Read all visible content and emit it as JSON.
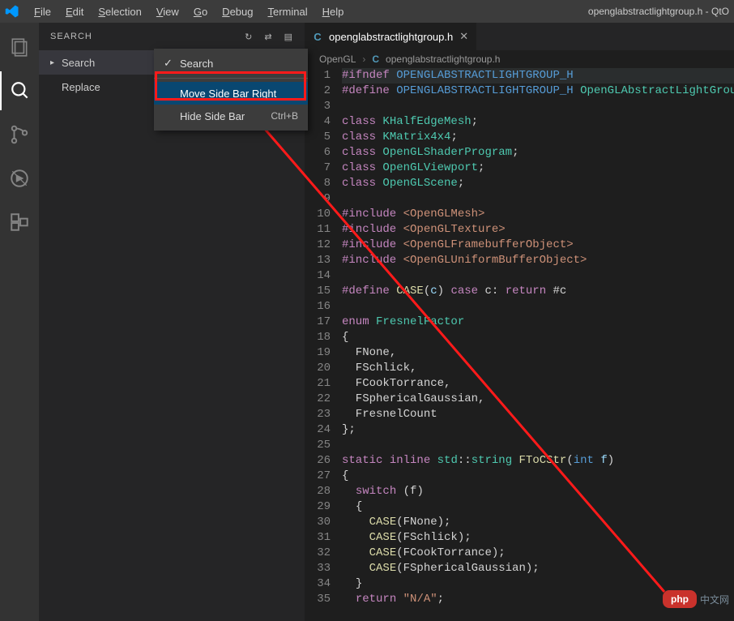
{
  "title_right": "openglabstractlightgroup.h - QtO",
  "menubar": [
    "File",
    "Edit",
    "Selection",
    "View",
    "Go",
    "Debug",
    "Terminal",
    "Help"
  ],
  "sidebar": {
    "title": "SEARCH",
    "rows": [
      {
        "label": "Search",
        "selected": true
      },
      {
        "label": "Replace",
        "selected": false
      }
    ]
  },
  "ctx": {
    "items": [
      {
        "label": "Search",
        "check": true
      },
      {
        "label": "Move Side Bar Right",
        "hl": true
      },
      {
        "label": "Hide Side Bar",
        "kb": "Ctrl+B"
      }
    ]
  },
  "tab": {
    "name": "openglabstractlightgroup.h"
  },
  "breadcrumb": {
    "folder": "OpenGL",
    "file": "openglabstractlightgroup.h"
  },
  "code": [
    {
      "n": 1,
      "html": "<span class='kw'>#ifndef</span> <span class='mac'>OPENGLABSTRACTLIGHTGROUP_H</span>",
      "hl": true
    },
    {
      "n": 2,
      "html": "<span class='kw'>#define</span> <span class='mac'>OPENGLABSTRACTLIGHTGROUP_H</span> <span class='cls'>OpenGLAbstractLightGroup</span>"
    },
    {
      "n": 3,
      "html": " "
    },
    {
      "n": 4,
      "html": "<span class='kw'>class</span> <span class='cls'>KHalfEdgeMesh</span><span class='pun'>;</span>"
    },
    {
      "n": 5,
      "html": "<span class='kw'>class</span> <span class='cls'>KMatrix4x4</span><span class='pun'>;</span>"
    },
    {
      "n": 6,
      "html": "<span class='kw'>class</span> <span class='cls'>OpenGLShaderProgram</span><span class='pun'>;</span>"
    },
    {
      "n": 7,
      "html": "<span class='kw'>class</span> <span class='cls'>OpenGLViewport</span><span class='pun'>;</span>"
    },
    {
      "n": 8,
      "html": "<span class='kw'>class</span> <span class='cls'>OpenGLScene</span><span class='pun'>;</span>"
    },
    {
      "n": 9,
      "html": " "
    },
    {
      "n": 10,
      "html": "<span class='kw'>#include</span> <span class='str'>&lt;OpenGLMesh&gt;</span>"
    },
    {
      "n": 11,
      "html": "<span class='kw'>#include</span> <span class='str'>&lt;OpenGLTexture&gt;</span>"
    },
    {
      "n": 12,
      "html": "<span class='kw'>#include</span> <span class='str'>&lt;OpenGLFramebufferObject&gt;</span>"
    },
    {
      "n": 13,
      "html": "<span class='kw'>#include</span> <span class='str'>&lt;OpenGLUniformBufferObject&gt;</span>"
    },
    {
      "n": 14,
      "html": " "
    },
    {
      "n": 15,
      "html": "<span class='kw'>#define</span> <span class='fn'>CASE</span><span class='pun'>(</span><span class='param'>c</span><span class='pun'>)</span> <span class='kw'>case</span> c<span class='pun'>:</span> <span class='kw'>return</span> <span class='pun'>#</span>c"
    },
    {
      "n": 16,
      "html": " "
    },
    {
      "n": 17,
      "html": "<span class='kw'>enum</span> <span class='cls'>FresnelFactor</span>"
    },
    {
      "n": 18,
      "html": "<span class='pun'>{</span>"
    },
    {
      "n": 19,
      "html": "  FNone<span class='pun'>,</span>"
    },
    {
      "n": 20,
      "html": "  FSchlick<span class='pun'>,</span>"
    },
    {
      "n": 21,
      "html": "  FCookTorrance<span class='pun'>,</span>"
    },
    {
      "n": 22,
      "html": "  FSphericalGaussian<span class='pun'>,</span>"
    },
    {
      "n": 23,
      "html": "  FresnelCount"
    },
    {
      "n": 24,
      "html": "<span class='pun'>};</span>"
    },
    {
      "n": 25,
      "html": " "
    },
    {
      "n": 26,
      "html": "<span class='kw'>static</span> <span class='kw'>inline</span> <span class='cls'>std</span><span class='pun'>::</span><span class='cls'>string</span> <span class='fn'>FToCStr</span><span class='pun'>(</span><span class='type'>int</span> <span class='param'>f</span><span class='pun'>)</span>"
    },
    {
      "n": 27,
      "html": "<span class='pun'>{</span>"
    },
    {
      "n": 28,
      "html": "  <span class='kw'>switch</span> <span class='pun'>(</span>f<span class='pun'>)</span>"
    },
    {
      "n": 29,
      "html": "  <span class='pun'>{</span>"
    },
    {
      "n": 30,
      "html": "    <span class='fn'>CASE</span><span class='pun'>(</span>FNone<span class='pun'>);</span>"
    },
    {
      "n": 31,
      "html": "    <span class='fn'>CASE</span><span class='pun'>(</span>FSchlick<span class='pun'>);</span>"
    },
    {
      "n": 32,
      "html": "    <span class='fn'>CASE</span><span class='pun'>(</span>FCookTorrance<span class='pun'>);</span>"
    },
    {
      "n": 33,
      "html": "    <span class='fn'>CASE</span><span class='pun'>(</span>FSphericalGaussian<span class='pun'>);</span>"
    },
    {
      "n": 34,
      "html": "  <span class='pun'>}</span>"
    },
    {
      "n": 35,
      "html": "  <span class='kw'>return</span> <span class='str'>\"N/A\"</span><span class='pun'>;</span>"
    }
  ],
  "watermark": {
    "brand": "php",
    "txt": "中文网"
  }
}
